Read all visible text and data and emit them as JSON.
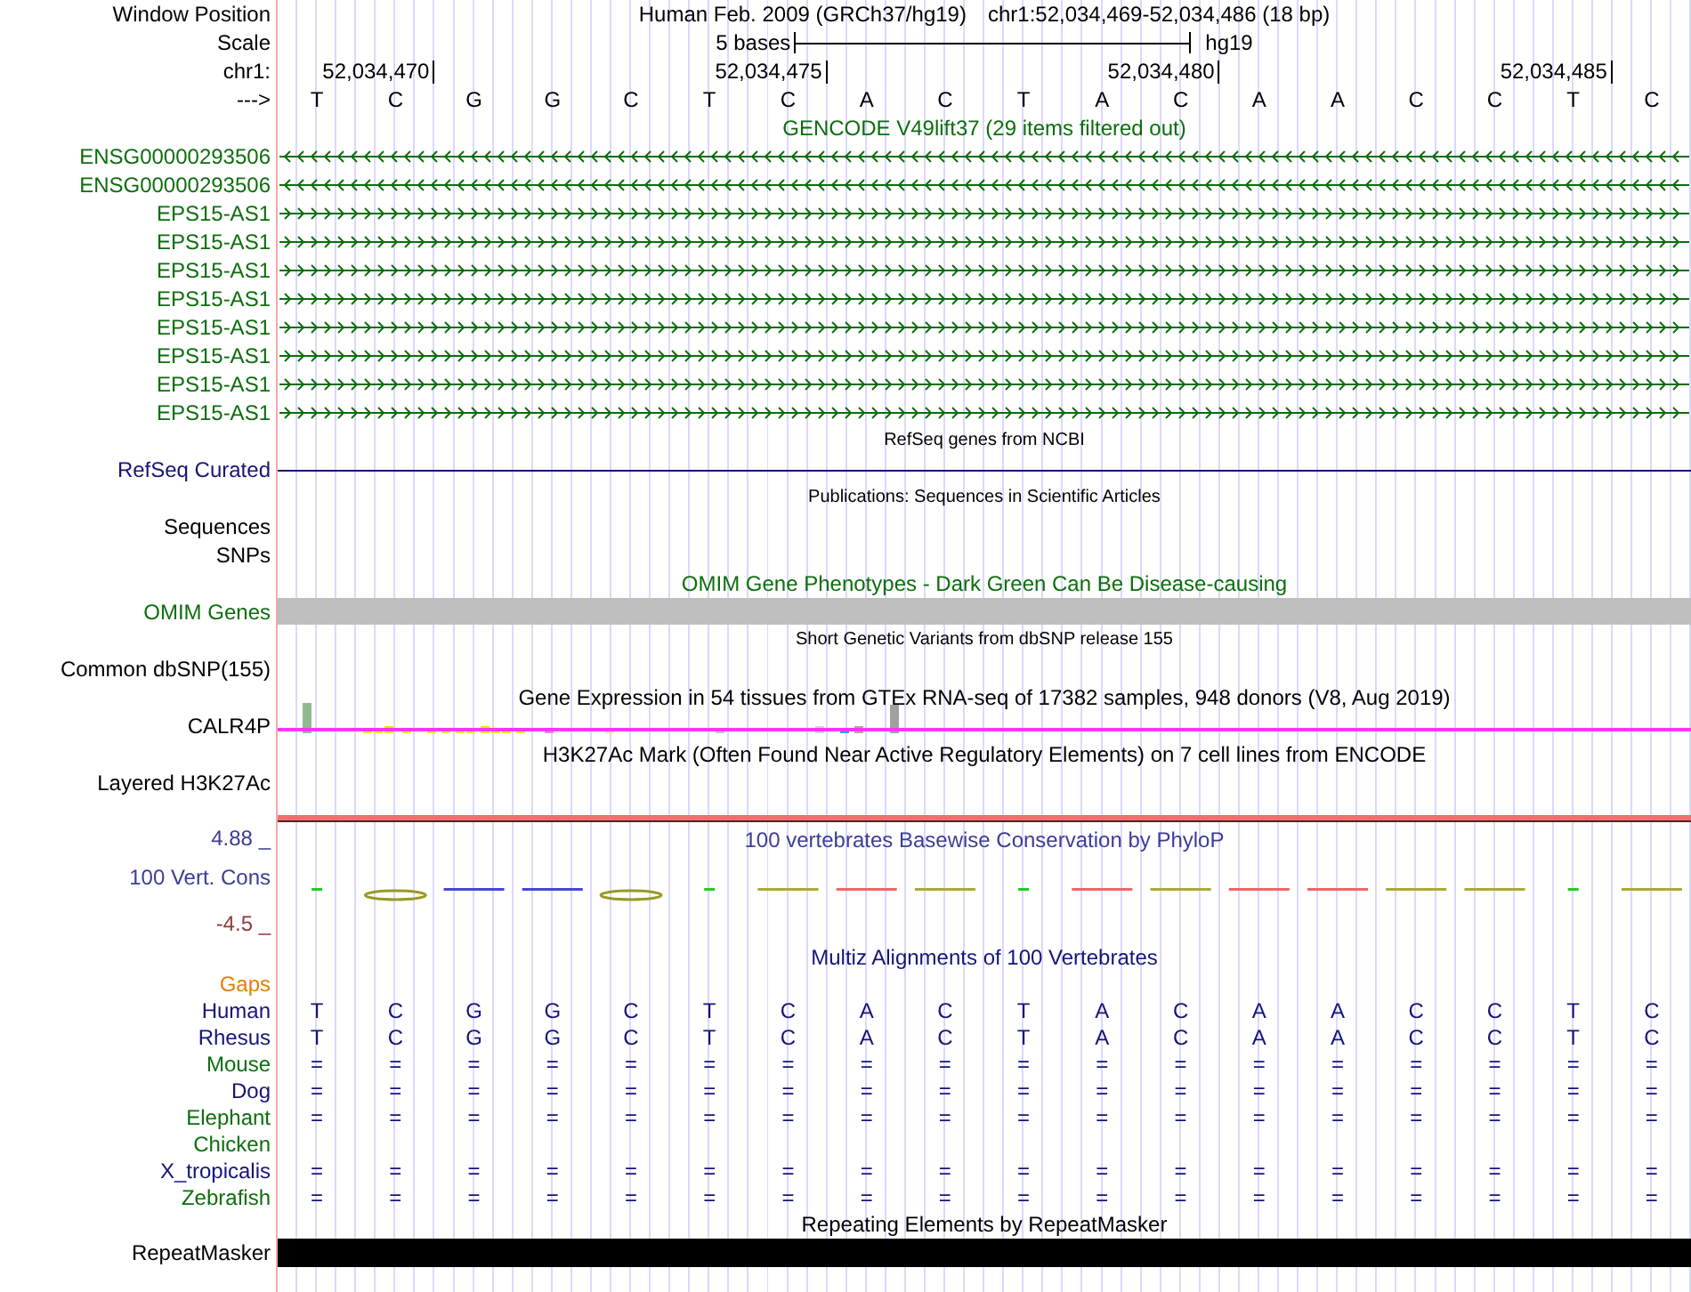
{
  "header": {
    "position_label": "Window Position",
    "assembly": "Human Feb. 2009 (GRCh37/hg19)",
    "position": "chr1:52,034,469-52,034,486 (18 bp)",
    "scale_label": "Scale",
    "scale_text": "5 bases",
    "scale_db": "hg19",
    "chrom_label": "chr1:",
    "ticks": [
      {
        "label": "52,034,470"
      },
      {
        "label": "52,034,475"
      },
      {
        "label": "52,034,480"
      },
      {
        "label": "52,034,485"
      }
    ],
    "strand_label": "--->",
    "bases": [
      "T",
      "C",
      "G",
      "G",
      "C",
      "T",
      "C",
      "A",
      "C",
      "T",
      "A",
      "C",
      "A",
      "A",
      "C",
      "C",
      "T",
      "C"
    ]
  },
  "tracks": [
    {
      "kind": "genes",
      "title": "GENCODE V49lift37 (29 items filtered out)",
      "items": [
        {
          "name": "ENSG00000293506",
          "kind": "reverse"
        },
        {
          "name": "ENSG00000293506",
          "kind": "reverse"
        },
        {
          "name": "EPS15-AS1",
          "kind": "forward"
        },
        {
          "name": "EPS15-AS1",
          "kind": "forward"
        },
        {
          "name": "EPS15-AS1",
          "kind": "forward"
        },
        {
          "name": "EPS15-AS1",
          "kind": "forward"
        },
        {
          "name": "EPS15-AS1",
          "kind": "forward"
        },
        {
          "name": "EPS15-AS1",
          "kind": "forward"
        },
        {
          "name": "EPS15-AS1",
          "kind": "forward"
        },
        {
          "name": "EPS15-AS1",
          "kind": "forward"
        }
      ]
    },
    {
      "kind": "refseq",
      "title": "RefSeq genes from NCBI",
      "label": "RefSeq Curated"
    },
    {
      "kind": "empty",
      "title": "Publications: Sequences in Scientific Articles",
      "labels": [
        "Sequences",
        "SNPs"
      ]
    },
    {
      "kind": "omim",
      "title": "OMIM Gene Phenotypes - Dark Green Can Be Disease-causing",
      "label": "OMIM Genes"
    },
    {
      "kind": "empty",
      "title": "Short Genetic Variants from dbSNP release 155",
      "labels": [
        "Common dbSNP(155)"
      ]
    },
    {
      "kind": "gtex",
      "title": "Gene Expression in 54 tissues from GTEx RNA-seq of 17382 samples, 948 donors (V8, Aug 2019)",
      "label": "CALR4P"
    },
    {
      "kind": "h3k27ac",
      "title": "H3K27Ac Mark (Often Found Near Active Regulatory Elements) on 7 cell lines from ENCODE",
      "label": "Layered H3K27Ac"
    },
    {
      "kind": "phylop",
      "title": "100 vertebrates Basewise Conservation by PhyloP",
      "label": "100 Vert. Cons",
      "ymax": "4.88 _",
      "ymin": "-4.5 _"
    },
    {
      "kind": "multiz",
      "title": "Multiz Alignments of 100 Vertebrates",
      "gaps": "Gaps",
      "species": [
        {
          "name": "Human",
          "color": "#141478",
          "bases": [
            "T",
            "C",
            "G",
            "G",
            "C",
            "T",
            "C",
            "A",
            "C",
            "T",
            "A",
            "C",
            "A",
            "A",
            "C",
            "C",
            "T",
            "C"
          ]
        },
        {
          "name": "Rhesus",
          "color": "#141478",
          "bases": [
            "T",
            "C",
            "G",
            "G",
            "C",
            "T",
            "C",
            "A",
            "C",
            "T",
            "A",
            "C",
            "A",
            "A",
            "C",
            "C",
            "T",
            "C"
          ]
        },
        {
          "name": "Mouse",
          "color": "#0c6e0c",
          "bases": [
            "=",
            "=",
            "=",
            "=",
            "=",
            "=",
            "=",
            "=",
            "=",
            "=",
            "=",
            "=",
            "=",
            "=",
            "=",
            "=",
            "=",
            "="
          ]
        },
        {
          "name": "Dog",
          "color": "#141478",
          "bases": [
            "=",
            "=",
            "=",
            "=",
            "=",
            "=",
            "=",
            "=",
            "=",
            "=",
            "=",
            "=",
            "=",
            "=",
            "=",
            "=",
            "=",
            "="
          ]
        },
        {
          "name": "Elephant",
          "color": "#0c6e0c",
          "bases": [
            "=",
            "=",
            "=",
            "=",
            "=",
            "=",
            "=",
            "=",
            "=",
            "=",
            "=",
            "=",
            "=",
            "=",
            "=",
            "=",
            "=",
            "="
          ]
        },
        {
          "name": "Chicken",
          "color": "#0c6e0c"
        },
        {
          "name": "X_tropicalis",
          "color": "#141478",
          "bases": [
            "=",
            "=",
            "=",
            "=",
            "=",
            "=",
            "=",
            "=",
            "=",
            "=",
            "=",
            "=",
            "=",
            "=",
            "=",
            "=",
            "=",
            "="
          ]
        },
        {
          "name": "Zebrafish",
          "color": "#0c6e0c",
          "bases": [
            "=",
            "=",
            "=",
            "=",
            "=",
            "=",
            "=",
            "=",
            "=",
            "=",
            "=",
            "=",
            "=",
            "=",
            "=",
            "=",
            "=",
            "="
          ]
        }
      ]
    },
    {
      "kind": "repeat",
      "title": "Repeating Elements by RepeatMasker",
      "label": "RepeatMasker"
    }
  ]
}
